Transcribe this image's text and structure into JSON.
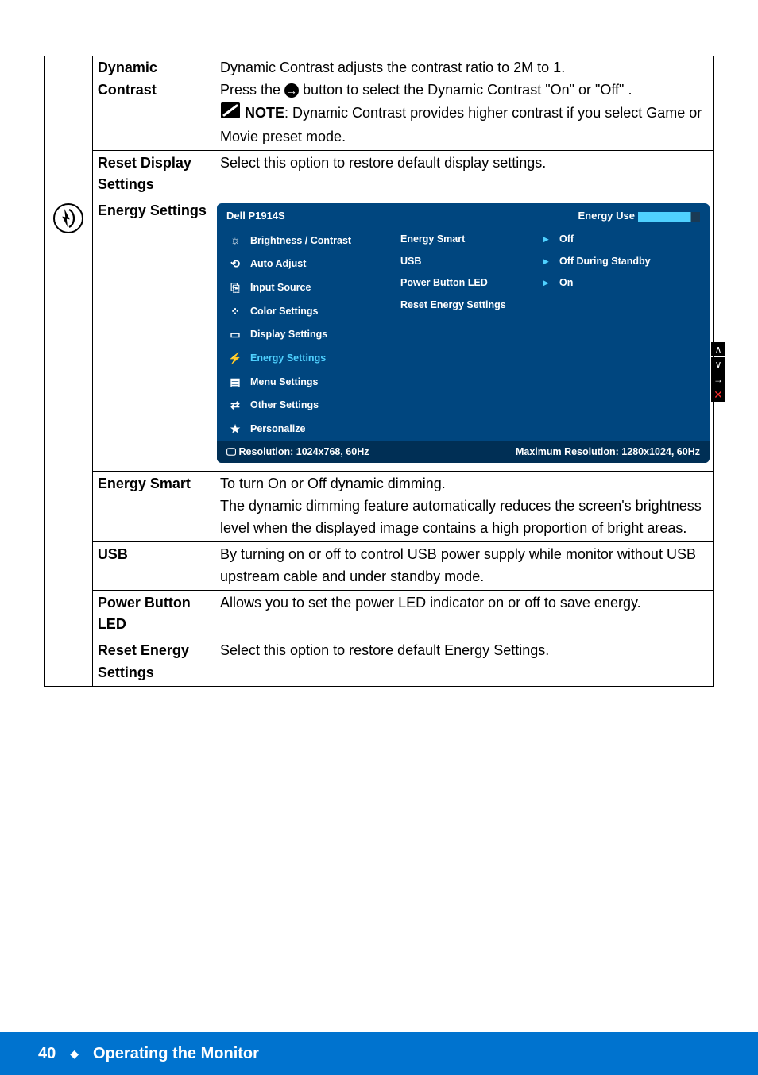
{
  "rows": {
    "dynamic_contrast": {
      "name": "Dynamic Contrast",
      "desc_line1": "Dynamic Contrast adjusts the contrast ratio to 2M to 1.",
      "press_the": "Press the ",
      "press_the_2": " button to select the Dynamic Contrast \"On\" or \"Off\" .",
      "note_label": "NOTE",
      "note_body": ": Dynamic Contrast provides higher contrast if you select Game or Movie preset mode."
    },
    "reset_display": {
      "name": "Reset Display Settings",
      "desc": "Select this option to restore default display settings."
    },
    "energy_settings": {
      "name": "Energy Settings"
    },
    "energy_smart": {
      "name": "Energy Smart",
      "line1": "To turn On or Off dynamic dimming.",
      "line2": "The dynamic dimming feature automatically reduces the screen's brightness level when the displayed image contains a high proportion of bright areas."
    },
    "usb": {
      "name": "USB",
      "desc": "By turning on or off to control USB power supply while monitor without USB upstream cable and under standby mode."
    },
    "power_button_led": {
      "name": "Power Button LED",
      "desc": "Allows you to set the power LED indicator on or off to save energy."
    },
    "reset_energy": {
      "name": "Reset Energy Settings",
      "desc": "Select this option to restore default Energy Settings."
    }
  },
  "osd": {
    "title": "Dell P1914S",
    "energy_use": "Energy Use",
    "left": {
      "brightness": "Brightness / Contrast",
      "auto_adjust": "Auto Adjust",
      "input_source": "Input Source",
      "color_settings": "Color Settings",
      "display_settings": "Display Settings",
      "energy_settings": "Energy Settings",
      "menu_settings": "Menu Settings",
      "other_settings": "Other Settings",
      "personalize": "Personalize"
    },
    "right": {
      "energy_smart": {
        "label": "Energy Smart",
        "value": "Off"
      },
      "usb": {
        "label": "USB",
        "value": "Off During Standby"
      },
      "power_button_led": {
        "label": "Power Button LED",
        "value": "On"
      },
      "reset_energy": {
        "label": "Reset Energy Settings"
      }
    },
    "footer": {
      "resolution": "Resolution: 1024x768, 60Hz",
      "max": "Maximum Resolution: 1280x1024, 60Hz"
    }
  },
  "footer": {
    "page": "40",
    "section": "Operating the Monitor"
  }
}
